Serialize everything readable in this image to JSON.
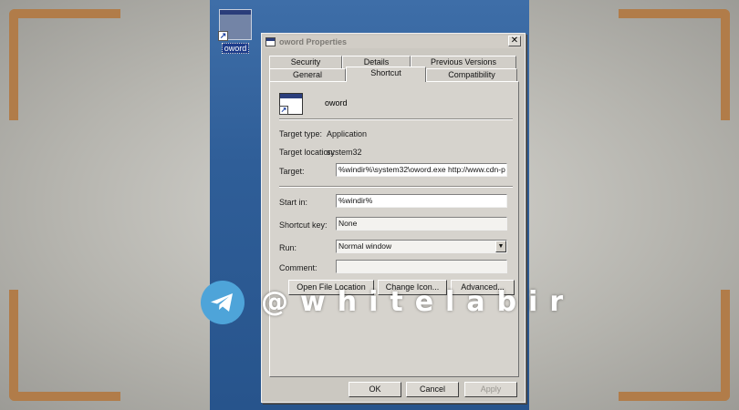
{
  "desktop": {
    "icon_label": "oword"
  },
  "dialog": {
    "title": "oword Properties",
    "close_glyph": "✕",
    "tabs_row1": [
      "Security",
      "Details",
      "Previous Versions"
    ],
    "tabs_row2": [
      "General",
      "Shortcut",
      "Compatibility"
    ],
    "active_tab": "Shortcut",
    "app_name": "oword",
    "target_type_label": "Target type:",
    "target_type_value": "Application",
    "target_location_label": "Target location:",
    "target_location_value": "system32",
    "target_label": "Target:",
    "target_value": "%windir%\\system32\\oword.exe http://www.cdn-p",
    "start_in_label": "Start in:",
    "start_in_value": "%windir%",
    "shortcut_key_label": "Shortcut key:",
    "shortcut_key_value": "None",
    "run_label": "Run:",
    "run_value": "Normal window",
    "comment_label": "Comment:",
    "comment_value": "",
    "open_file_location": "Open File Location",
    "change_icon": "Change Icon...",
    "advanced": "Advanced...",
    "ok": "OK",
    "cancel": "Cancel",
    "apply": "Apply"
  },
  "watermark": {
    "text": "@whitelabir",
    "color": "#4ea4d9"
  },
  "colors": {
    "desktop_blue": "#2f5e98",
    "corner_bracket": "#b17c49",
    "dialog_face": "#d6d3cd"
  }
}
